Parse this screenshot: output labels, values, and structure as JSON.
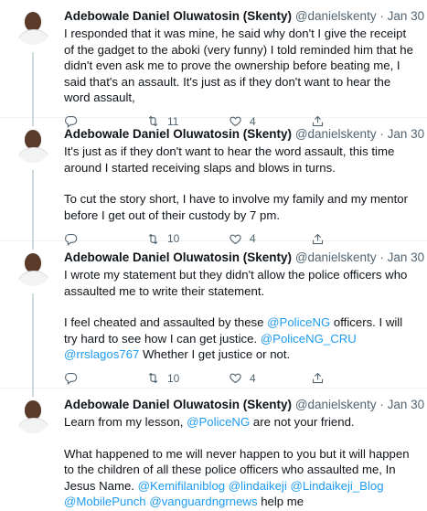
{
  "tweets": [
    {
      "name": "Adebowale Daniel Oluwatosin (Skenty)",
      "handle": "@danielskenty",
      "date": "Jan 30",
      "paragraphs": [
        [
          {
            "text": "I responded that it was mine, he said why don't I give the receipt of the gadget to the aboki (very funny) I told reminded him that he didn't even ask me to prove the ownership before beating me, I said that's an assault. It's just as if they don't want to hear the word assault,"
          }
        ]
      ],
      "retweets": "11",
      "likes": "4"
    },
    {
      "name": "Adebowale Daniel Oluwatosin (Skenty)",
      "handle": "@danielskenty",
      "date": "Jan 30",
      "paragraphs": [
        [
          {
            "text": "It's just as if they don't want to hear the word assault, this time around I started receiving slaps and blows in turns."
          }
        ],
        [
          {
            "text": "To cut the story short, I have to involve my family and my mentor before I get out of their custody by 7 pm."
          }
        ]
      ],
      "retweets": "10",
      "likes": "4"
    },
    {
      "name": "Adebowale Daniel Oluwatosin (Skenty)",
      "handle": "@danielskenty",
      "date": "Jan 30",
      "paragraphs": [
        [
          {
            "text": "I wrote my statement but they didn't allow the police officers who assaulted me to write their statement."
          }
        ],
        [
          {
            "text": "I feel cheated and assaulted by these "
          },
          {
            "text": "@PoliceNG",
            "link": true
          },
          {
            "text": " officers. I will try hard to see how I can get justice. "
          },
          {
            "text": "@PoliceNG_CRU",
            "link": true
          },
          {
            "text": " "
          },
          {
            "text": "@rrslagos767",
            "link": true
          },
          {
            "text": " Whether I get justice or not."
          }
        ]
      ],
      "retweets": "10",
      "likes": "4"
    },
    {
      "name": "Adebowale Daniel Oluwatosin (Skenty)",
      "handle": "@danielskenty",
      "date": "Jan 30",
      "paragraphs": [
        [
          {
            "text": "Learn from my lesson, "
          },
          {
            "text": "@PoliceNG",
            "link": true
          },
          {
            "text": " are not your friend."
          }
        ],
        [
          {
            "text": "What happened to me will never happen to you but it will happen to the children of all these police officers who assaulted me, In Jesus Name. "
          },
          {
            "text": "@Kemifilaniblog",
            "link": true
          },
          {
            "text": " "
          },
          {
            "text": "@lindaikeji",
            "link": true
          },
          {
            "text": " "
          },
          {
            "text": "@Lindaikeji_Blog",
            "link": true
          },
          {
            "text": " "
          },
          {
            "text": "@MobilePunch",
            "link": true
          },
          {
            "text": " "
          },
          {
            "text": "@vanguardngrnews",
            "link": true
          },
          {
            "text": " help me"
          }
        ]
      ],
      "retweets": "",
      "likes": ""
    }
  ],
  "icons": {
    "reply": "reply-icon",
    "retweet": "retweet-icon",
    "like": "heart-icon",
    "share": "share-icon"
  },
  "colors": {
    "link": "#1d9bf0",
    "text": "#0f1419",
    "muted": "#536471",
    "thread_line": "#cfd9de"
  }
}
